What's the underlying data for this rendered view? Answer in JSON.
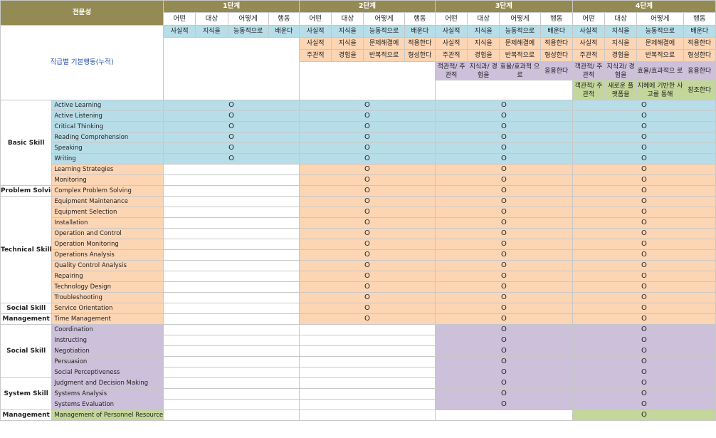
{
  "header": {
    "field_label": "전문성",
    "stage_labels": [
      "1단계",
      "2단계",
      "3단계",
      "4단계"
    ],
    "sub_labels": [
      "어떤",
      "대상",
      "어떻게",
      "행동"
    ]
  },
  "basic": {
    "label": "직급별 기본행동(누적)",
    "stage1": [
      [
        "사실적",
        "지식을",
        "능동적으로",
        "배운다"
      ]
    ],
    "stage2": [
      [
        "사실적",
        "지식을",
        "능동적으로",
        "배운다"
      ],
      [
        "사실적",
        "지식을",
        "문제해결에",
        "적용한다"
      ],
      [
        "주관적",
        "경험을",
        "반복적으로",
        "형성한다"
      ]
    ],
    "stage3": [
      [
        "사실적",
        "지식을",
        "능동적으로",
        "배운다"
      ],
      [
        "사실적",
        "지식을",
        "문제해결에",
        "적용한다"
      ],
      [
        "주관적",
        "경험을",
        "반복적으로",
        "형성한다"
      ],
      [
        "객관적/ 주관적",
        "지식과/ 경험을",
        "효율/효과적 으로",
        "응용한다"
      ]
    ],
    "stage4": [
      [
        "사실적",
        "지식을",
        "능동적으로",
        "배운다"
      ],
      [
        "사실적",
        "지식을",
        "문제해결에",
        "적용한다"
      ],
      [
        "주관적",
        "경험을",
        "반복적으로",
        "형성한다"
      ],
      [
        "객관적/ 주관적",
        "지식과/ 경험을",
        "효율/효과적으 로",
        "응용한다"
      ],
      [
        "객관적/ 주관적",
        "새로운 플랫폼을",
        "지혜에 기반한 사고를 통해",
        "창조한다"
      ]
    ]
  },
  "mark": "O",
  "groups": [
    {
      "label": "Basic Skill",
      "skills": [
        {
          "name": "Active Learning",
          "stages": [
            1,
            1,
            1,
            1
          ],
          "color": "b"
        },
        {
          "name": "Active Listening",
          "stages": [
            1,
            1,
            1,
            1
          ],
          "color": "b"
        },
        {
          "name": "Critical Thinking",
          "stages": [
            1,
            1,
            1,
            1
          ],
          "color": "b"
        },
        {
          "name": "Reading Comprehension",
          "stages": [
            1,
            1,
            1,
            1
          ],
          "color": "b"
        },
        {
          "name": "Speaking",
          "stages": [
            1,
            1,
            1,
            1
          ],
          "color": "b"
        },
        {
          "name": "Writing",
          "stages": [
            1,
            1,
            1,
            1
          ],
          "color": "b"
        },
        {
          "name": "Learning Strategies",
          "stages": [
            0,
            1,
            1,
            1
          ],
          "color": "o"
        },
        {
          "name": "Monitoring",
          "stages": [
            0,
            1,
            1,
            1
          ],
          "color": "o"
        }
      ]
    },
    {
      "label": "Problem Solving",
      "skills": [
        {
          "name": "Complex Problem Solving",
          "stages": [
            0,
            1,
            1,
            1
          ],
          "color": "o"
        }
      ]
    },
    {
      "label": "Technical Skill",
      "skills": [
        {
          "name": "Equipment Maintenance",
          "stages": [
            0,
            1,
            1,
            1
          ],
          "color": "o"
        },
        {
          "name": "Equipment Selection",
          "stages": [
            0,
            1,
            1,
            1
          ],
          "color": "o"
        },
        {
          "name": "Installation",
          "stages": [
            0,
            1,
            1,
            1
          ],
          "color": "o"
        },
        {
          "name": "Operation and Control",
          "stages": [
            0,
            1,
            1,
            1
          ],
          "color": "o"
        },
        {
          "name": "Operation Monitoring",
          "stages": [
            0,
            1,
            1,
            1
          ],
          "color": "o"
        },
        {
          "name": "Operations Analysis",
          "stages": [
            0,
            1,
            1,
            1
          ],
          "color": "o"
        },
        {
          "name": "Quality Control Analysis",
          "stages": [
            0,
            1,
            1,
            1
          ],
          "color": "o"
        },
        {
          "name": "Repairing",
          "stages": [
            0,
            1,
            1,
            1
          ],
          "color": "o"
        },
        {
          "name": "Technology Design",
          "stages": [
            0,
            1,
            1,
            1
          ],
          "color": "o"
        },
        {
          "name": "Troubleshooting",
          "stages": [
            0,
            1,
            1,
            1
          ],
          "color": "o"
        }
      ]
    },
    {
      "label": "Social Skill",
      "skills": [
        {
          "name": "Service Orientation",
          "stages": [
            0,
            1,
            1,
            1
          ],
          "color": "o"
        }
      ]
    },
    {
      "label": "Management",
      "skills": [
        {
          "name": "Time Management",
          "stages": [
            0,
            1,
            1,
            1
          ],
          "color": "o"
        }
      ]
    },
    {
      "label": "Social Skill",
      "skills": [
        {
          "name": "Coordination",
          "stages": [
            0,
            0,
            1,
            1
          ],
          "color": "p"
        },
        {
          "name": "Instructing",
          "stages": [
            0,
            0,
            1,
            1
          ],
          "color": "p"
        },
        {
          "name": "Negotiation",
          "stages": [
            0,
            0,
            1,
            1
          ],
          "color": "p"
        },
        {
          "name": "Persuasion",
          "stages": [
            0,
            0,
            1,
            1
          ],
          "color": "p"
        },
        {
          "name": "Social Perceptiveness",
          "stages": [
            0,
            0,
            1,
            1
          ],
          "color": "p"
        }
      ]
    },
    {
      "label": "System Skill",
      "skills": [
        {
          "name": "Judgment and Decision Making",
          "stages": [
            0,
            0,
            1,
            1
          ],
          "color": "p"
        },
        {
          "name": "Systems Analysis",
          "stages": [
            0,
            0,
            1,
            1
          ],
          "color": "p"
        },
        {
          "name": "Systems Evaluation",
          "stages": [
            0,
            0,
            1,
            1
          ],
          "color": "p"
        }
      ]
    },
    {
      "label": "Management",
      "skills": [
        {
          "name": "Management of Personnel Resources",
          "stages": [
            0,
            0,
            0,
            1
          ],
          "color": "g"
        }
      ]
    }
  ],
  "colors": {
    "header": "#948a54",
    "blue": "#b7dde8",
    "orange": "#fcd5b4",
    "purple": "#ccc0da",
    "green": "#c4d79b"
  }
}
